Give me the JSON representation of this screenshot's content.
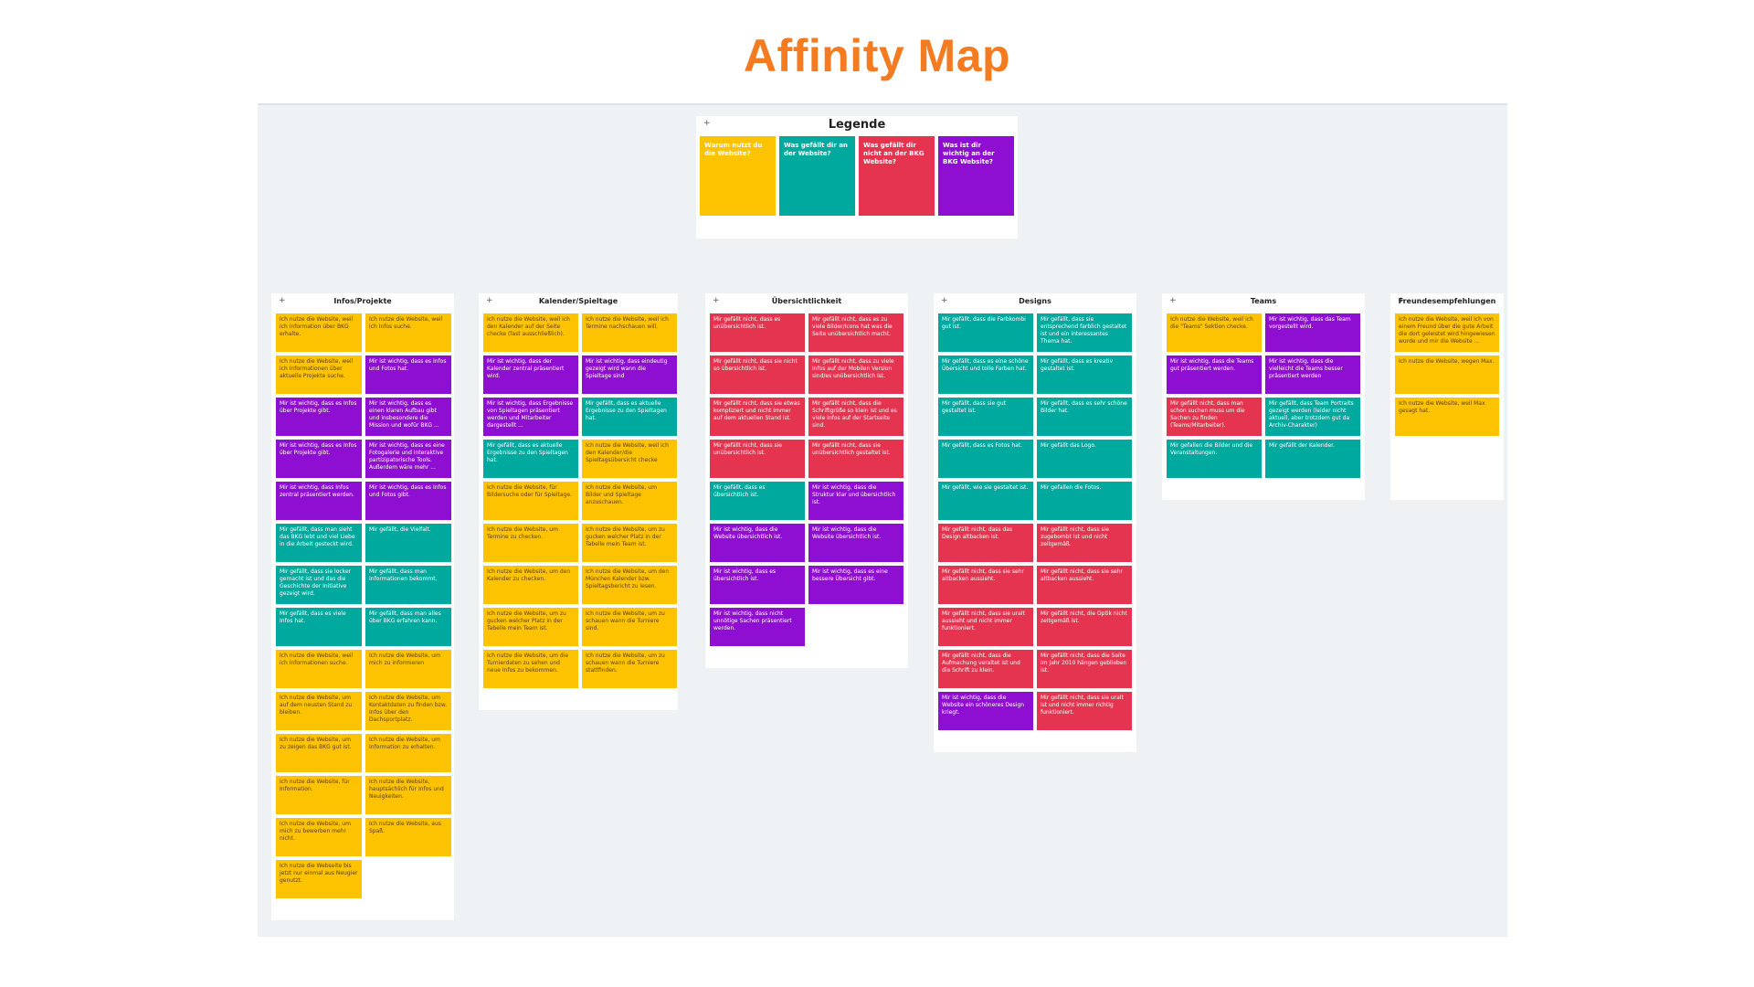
{
  "page_title": "Affinity Map",
  "colors": {
    "title": "#F47B20",
    "yellow": "#FDC300",
    "teal": "#00A99D",
    "red": "#E5344F",
    "purple": "#8E0FD1",
    "board": "#EEF2F4"
  },
  "icons": {
    "add": "plus-icon"
  },
  "legend": {
    "title": "Legende",
    "add_label": "+",
    "items": [
      {
        "c": "y",
        "text": "Warum nutzt du die Website?"
      },
      {
        "c": "t",
        "text": "Was gefällt dir an der Website?"
      },
      {
        "c": "r",
        "text": "Was gefällt dir nicht an der BKG Website?"
      },
      {
        "c": "p",
        "text": "Was ist dir wichtig an der BKG Website?"
      }
    ]
  },
  "columns": [
    {
      "title": "Infos/Projekte",
      "add_label": "+",
      "notes": [
        {
          "c": "y",
          "text": "Ich nutze die Website, weil ich Information über BKG erhalte."
        },
        {
          "c": "y",
          "text": "Ich nutze die Website, weil ich Infos suche."
        },
        {
          "c": "y",
          "text": "Ich nutze die Website, weil ich Informationen über aktuelle Projekte suche."
        },
        {
          "c": "p",
          "text": "Mir ist wichtig, dass es Infos und Fotos hat."
        },
        {
          "c": "p",
          "text": "Mir ist wichtig, dass es Infos über Projekte gibt."
        },
        {
          "c": "p",
          "text": "Mir ist wichtig, dass es einen klaren Aufbau gibt und insbesondere die Mission und wofür BKG ..."
        },
        {
          "c": "p",
          "text": "Mir ist wichtig, dass es Infos über Projekte gibt."
        },
        {
          "c": "p",
          "text": "Mir ist wichtig, dass es eine Fotogalerie und interaktive partizipatorische Tools. Außerdem wäre mehr ..."
        },
        {
          "c": "p",
          "text": "Mir ist wichtig, dass Infos zentral präsentiert werden."
        },
        {
          "c": "p",
          "text": "Mir ist wichtig, dass es Infos und Fotos gibt."
        },
        {
          "c": "t",
          "text": "Mir gefällt, dass man sieht das BKG lebt und viel Liebe in die Arbeit gesteckt wird."
        },
        {
          "c": "t",
          "text": "Mir gefällt, die Vielfalt."
        },
        {
          "c": "t",
          "text": "Mir gefällt, dass sie locker gemacht ist und das die Geschichte der Initiative gezeigt wird."
        },
        {
          "c": "t",
          "text": "Mir gefällt, dass man Informationen bekommt."
        },
        {
          "c": "t",
          "text": "Mir gefällt, dass es viele Infos hat."
        },
        {
          "c": "t",
          "text": "Mir gefällt, dass man alles über BKG erfahren kann."
        },
        {
          "c": "y",
          "text": "Ich nutze die Website, weil ich Informationen suche."
        },
        {
          "c": "y",
          "text": "Ich nutze die Website, um mich zu informieren"
        },
        {
          "c": "y",
          "text": "Ich nutze die Website, um auf dem neusten Stand zu bleiben."
        },
        {
          "c": "y",
          "text": "Ich nutze die Website, um Kontaktdaten zu finden bzw. Infos über den Dachsportplatz."
        },
        {
          "c": "y",
          "text": "Ich nutze die Website, um zu zeigen das BKG gut ist."
        },
        {
          "c": "y",
          "text": "Ich nutze die Website, um Information zu erhalten."
        },
        {
          "c": "y",
          "text": "Ich nutze die Website, für Information."
        },
        {
          "c": "y",
          "text": "Ich nutze die Website, hauptsächlich für Infos und Neuigkeiten."
        },
        {
          "c": "y",
          "text": "Ich nutze die Website, um mich zu bewerben mehr nicht."
        },
        {
          "c": "y",
          "text": "Ich nutze die Website, aus Spaß."
        },
        {
          "c": "y",
          "text": "Ich nutze die Webseite bis jetzt nur einmal aus Neugier genutzt."
        }
      ]
    },
    {
      "title": "Kalender/Spieltage",
      "add_label": "+",
      "notes": [
        {
          "c": "y",
          "text": "Ich nutze die Website, weil ich den Kalender auf der Seite checke (fast ausschließlich)."
        },
        {
          "c": "y",
          "text": "Ich nutze die Website, weil ich Termine nachschauen will."
        },
        {
          "c": "p",
          "text": "Mir ist wichtig, dass der Kalender zentral präsentiert wird."
        },
        {
          "c": "p",
          "text": "Mir ist wichtig, dass eindeutig gezeigt wird wann die Spieltage sind"
        },
        {
          "c": "p",
          "text": "Mir ist wichtig, dass Ergebnisse von Spieltagen präsentiert werden und Mitarbeiter dargestellt ..."
        },
        {
          "c": "t",
          "text": "Mir gefällt, dass es aktuelle Ergebnisse zu den Spieltagen hat."
        },
        {
          "c": "t",
          "text": "Mir gefällt, dass es aktuelle Ergebnisse zu den Spieltagen hat."
        },
        {
          "c": "y",
          "text": "Ich nutze die Website, weil ich den Kalender/die Spieltagsübersicht checke"
        },
        {
          "c": "y",
          "text": "Ich nutze die Website, für Bildersuche oder für Spieltage."
        },
        {
          "c": "y",
          "text": "Ich nutze die Website, um Bilder und Spieltage anzuschauen."
        },
        {
          "c": "y",
          "text": "Ich nutze die Website, um Termine zu checken."
        },
        {
          "c": "y",
          "text": "Ich nutze die Website, um zu gucken welcher Platz in der Tabelle mein Team ist."
        },
        {
          "c": "y",
          "text": "Ich nutze die Website, um den Kalender zu checken."
        },
        {
          "c": "y",
          "text": "Ich nutze die Website, um den München Kalender bzw. Spieltagsbericht zu lesen."
        },
        {
          "c": "y",
          "text": "Ich nutze die Website, um zu gucken welcher Platz in der Tabelle mein Team ist."
        },
        {
          "c": "y",
          "text": "Ich nutze die Website, um zu schauen wann die Turniere sind."
        },
        {
          "c": "y",
          "text": "Ich nutze die Website, um die Turnierdaten zu sehen und neue Infos zu bekommen."
        },
        {
          "c": "y",
          "text": "Ich nutze die Website, um zu schauen wann die Turniere stattfinden."
        }
      ]
    },
    {
      "title": "Übersichtlichkeit",
      "add_label": "+",
      "notes": [
        {
          "c": "r",
          "text": "Mir gefällt nicht, dass es unübersichtlich ist."
        },
        {
          "c": "r",
          "text": "Mir gefällt nicht, dass es zu viele Bilder/Icons hat was die Seite unübersichtlich macht."
        },
        {
          "c": "r",
          "text": "Mir gefällt nicht, dass sie nicht so übersichtlich ist."
        },
        {
          "c": "r",
          "text": "Mir gefällt nicht, dass zu viele Infos auf der Mobilen Version sind/es unübersichtlich ist."
        },
        {
          "c": "r",
          "text": "Mir gefällt nicht, dass sie etwas kompliziert und nicht immer auf dem aktuellen Stand ist."
        },
        {
          "c": "r",
          "text": "Mir gefällt nicht, dass die Schriftgröße so klein ist und es viele Infos auf der Startseite sind."
        },
        {
          "c": "r",
          "text": "Mir gefällt nicht, dass sie unübersichtlich ist."
        },
        {
          "c": "r",
          "text": "Mir gefällt nicht, dass sie unübersichtlich gestaltet ist."
        },
        {
          "c": "t",
          "text": "Mir gefällt, dass es übersichtlich ist."
        },
        {
          "c": "p",
          "text": "Mir ist wichtig, dass die Struktur klar und übersichtlich ist."
        },
        {
          "c": "p",
          "text": "Mir ist wichtig, dass die Website übersichtlich ist."
        },
        {
          "c": "p",
          "text": "Mir ist wichtig, dass die Website übersichtlich ist."
        },
        {
          "c": "p",
          "text": "Mir ist wichtig, dass es übersichtlich ist."
        },
        {
          "c": "p",
          "text": "Mir ist wichtig, dass es eine bessere Übersicht gibt."
        },
        {
          "c": "p",
          "text": "Mir ist wichtig, dass nicht unnötige Sachen präsentiert werden."
        }
      ]
    },
    {
      "title": "Designs",
      "add_label": "+",
      "notes": [
        {
          "c": "t",
          "text": "Mir gefällt, dass die Farbkombi gut ist."
        },
        {
          "c": "t",
          "text": "Mir gefällt, dass sie entsprechend farblich gestaltet ist und ein interessantes Thema hat."
        },
        {
          "c": "t",
          "text": "Mir gefällt, dass es eine schöne Übersicht und tolle Farben hat."
        },
        {
          "c": "t",
          "text": "Mir gefällt, dass es kreativ gestaltet ist."
        },
        {
          "c": "t",
          "text": "Mir gefällt, dass sie gut gestaltet ist."
        },
        {
          "c": "t",
          "text": "Mir gefällt, dass es sehr schöne Bilder hat."
        },
        {
          "c": "t",
          "text": "Mir gefällt, dass es Fotos hat."
        },
        {
          "c": "t",
          "text": "Mir gefällt das Logo."
        },
        {
          "c": "t",
          "text": "Mir gefällt, wie sie gestaltet ist."
        },
        {
          "c": "t",
          "text": "Mir gefallen die Fotos."
        },
        {
          "c": "r",
          "text": "Mir gefällt nicht, dass das Design altbacken ist."
        },
        {
          "c": "r",
          "text": "Mir gefällt nicht, dass sie zugebombt ist und nicht zeitgemäß."
        },
        {
          "c": "r",
          "text": "Mir gefällt nicht, dass sie sehr altbacken aussieht."
        },
        {
          "c": "r",
          "text": "Mir gefällt nicht, dass sie sehr altbacken aussieht."
        },
        {
          "c": "r",
          "text": "Mir gefällt nicht, dass sie uralt aussieht und nicht immer funktioniert."
        },
        {
          "c": "r",
          "text": "Mir gefällt nicht, die Optik nicht zeitgemäß ist."
        },
        {
          "c": "r",
          "text": "Mir gefällt nicht, dass die Aufmachung veraltet ist und die Schrift zu klein."
        },
        {
          "c": "r",
          "text": "Mir gefällt nicht, dass die Seite im Jahr 2010 hängen geblieben ist."
        },
        {
          "c": "p",
          "text": "Mir ist wichtig, dass die Website ein schöneres Design kriegt."
        },
        {
          "c": "r",
          "text": "Mir gefällt nicht, dass sie uralt ist und nicht immer richtig funktioniert."
        }
      ]
    },
    {
      "title": "Teams",
      "add_label": "+",
      "notes": [
        {
          "c": "y",
          "text": "Ich nutze die Website, weil ich die \"Teams\" Sektion checke."
        },
        {
          "c": "p",
          "text": "Mir ist wichtig, dass das Team vorgestellt wird."
        },
        {
          "c": "p",
          "text": "Mir ist wichtig, dass die Teams gut präsentiert werden."
        },
        {
          "c": "p",
          "text": "Mir ist wichtig, dass die vielleicht die Teams besser präsentiert werden"
        },
        {
          "c": "r",
          "text": "Mir gefällt nicht, dass man schon suchen muss um die Sachen zu finden (Teams/Mitarbeiter)."
        },
        {
          "c": "t",
          "text": "Mir gefällt, dass Team Portraits gezeigt werden (leider nicht aktuell, aber trotzdem gut da Archiv-Charakter)"
        },
        {
          "c": "t",
          "text": "Mir gefallen die Bilder und die Veranstaltungen."
        },
        {
          "c": "t",
          "text": "Mir gefällt der Kalender."
        }
      ]
    },
    {
      "title": "Freundesempfehlungen",
      "add_label": "+",
      "notes": [
        {
          "c": "y",
          "text": "Ich nutze die Website, weil ich von einem Freund über die gute Arbeit die dort geleistet wird hingewiesen wurde und mir die Website ..."
        },
        {
          "c": "y",
          "text": "Ich nutze die Website, wegen Max."
        },
        {
          "c": "y",
          "text": "Ich nutze die Website, weil Max gesagt hat."
        }
      ]
    }
  ]
}
